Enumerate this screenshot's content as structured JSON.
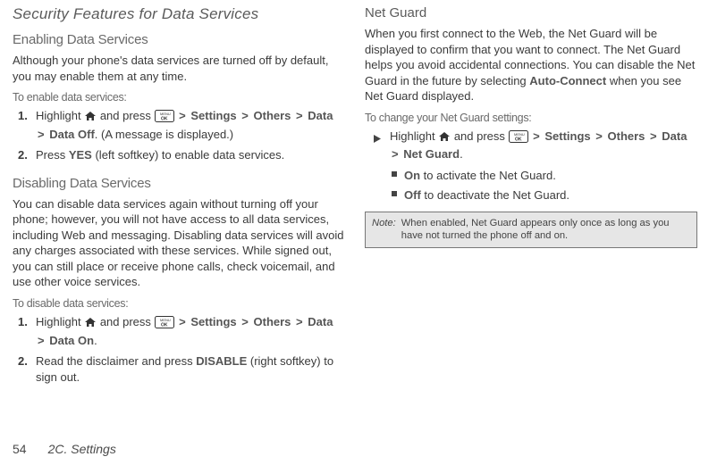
{
  "left": {
    "section_title": "Security Features for Data Services",
    "enable_heading": "Enabling Data Services",
    "enable_body": "Although your phone's data services are turned off by default, you may enable them at any time.",
    "enable_leadin": "To enable data services:",
    "enable_step1_a": "Highlight ",
    "enable_step1_b": " and press ",
    "enable_step1_settings": "Settings",
    "enable_step1_others": "Others",
    "enable_step1_data": "Data",
    "enable_step1_dataoff": "Data Off",
    "enable_step1_end": ". (A message is displayed.)",
    "enable_step2_a": "Press ",
    "enable_step2_yes": "YES",
    "enable_step2_b": " (left softkey) to enable data services.",
    "disable_heading": "Disabling Data Services",
    "disable_body": "You can disable data services again without turning off your phone; however, you will not have access to all data services, including Web and messaging. Disabling data services will avoid any charges associated with these services. While signed out, you can still place or receive phone calls, check voicemail, and use other voice services.",
    "disable_leadin": "To disable data services:",
    "disable_step1_a": "Highlight ",
    "disable_step1_b": " and press ",
    "disable_step1_settings": "Settings",
    "disable_step1_others": "Others",
    "disable_step1_data": "Data",
    "disable_step1_dataon": "Data On",
    "disable_step1_end": ".",
    "disable_step2_a": "Read the disclaimer and press ",
    "disable_step2_disable": "DISABLE",
    "disable_step2_b": " (right softkey) to sign out."
  },
  "right": {
    "ng_heading": "Net Guard",
    "ng_body_a": "When you first connect to the Web, the Net Guard will be displayed to confirm that you want to connect. The Net Guard helps you avoid accidental connections. You can disable the Net Guard in the future by selecting ",
    "ng_autoconnect": "Auto-Connect",
    "ng_body_b": " when you see Net Guard displayed.",
    "ng_leadin": "To change your Net Guard settings:",
    "ng_step_a": "Highlight ",
    "ng_step_b": " and press ",
    "ng_step_settings": "Settings",
    "ng_step_others": "Others",
    "ng_step_data": "Data",
    "ng_step_netguard": "Net Guard",
    "ng_step_end": ".",
    "ng_on_bold": "On",
    "ng_on_text": " to activate the Net Guard.",
    "ng_off_bold": "Off",
    "ng_off_text": " to deactivate the Net Guard.",
    "note_label": "Note:",
    "note_text": "When enabled, Net Guard appears only once as long as you have not turned the phone off and on."
  },
  "gt": ">",
  "footer": {
    "page_num": "54",
    "section": "2C. Settings"
  },
  "nums": {
    "one": "1.",
    "two": "2."
  }
}
